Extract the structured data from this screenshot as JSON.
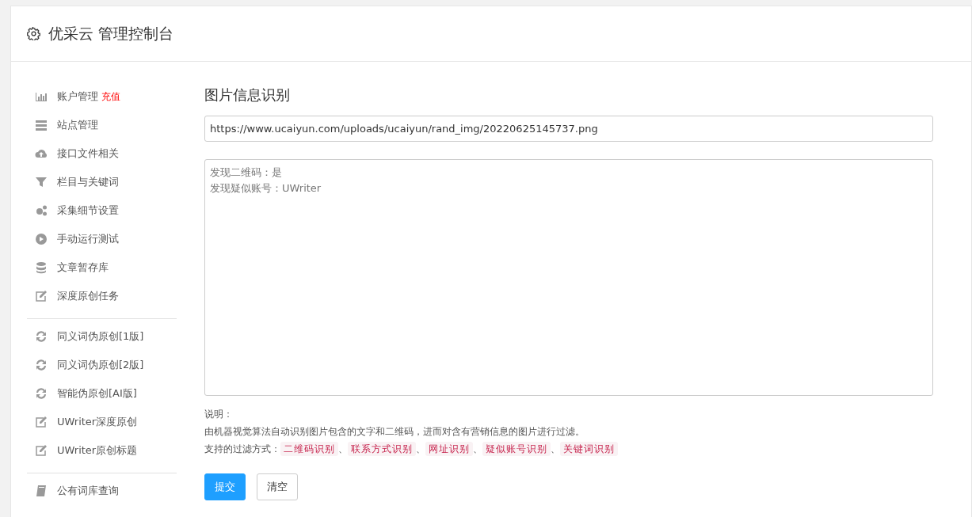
{
  "header": {
    "title": "优采云 管理控制台"
  },
  "sidebar": {
    "groups": [
      {
        "items": [
          {
            "label": "账户管理",
            "badge": "充值"
          },
          {
            "label": "站点管理"
          },
          {
            "label": "接口文件相关"
          },
          {
            "label": "栏目与关键词"
          },
          {
            "label": "采集细节设置"
          },
          {
            "label": "手动运行测试"
          },
          {
            "label": "文章暂存库"
          },
          {
            "label": "深度原创任务"
          }
        ]
      },
      {
        "items": [
          {
            "label": "同义词伪原创[1版]"
          },
          {
            "label": "同义词伪原创[2版]"
          },
          {
            "label": "智能伪原创[AI版]"
          },
          {
            "label": "UWriter深度原创"
          },
          {
            "label": "UWriter原创标题"
          }
        ]
      },
      {
        "items": [
          {
            "label": "公有词库查询"
          }
        ]
      }
    ]
  },
  "main": {
    "title": "图片信息识别",
    "url_field": {
      "value": "https://www.ucaiyun.com/uploads/ucaiyun/rand_img/20220625145737.png"
    },
    "result_lines": [
      "发现二维码：是",
      "发现疑似账号：UWriter"
    ],
    "note_label": "说明：",
    "note_text": "由机器视觉算法自动识别图片包含的文字和二维码，进而对含有营销信息的图片进行过滤。",
    "filters_label": "支持的过滤方式：",
    "separator": "、",
    "filters": [
      "二维码识别",
      "联系方式识别",
      "网址识别",
      "疑似账号识别",
      "关键词识别"
    ],
    "buttons": [
      {
        "label": "提交",
        "kind": "primary"
      },
      {
        "label": "清空",
        "kind": "default"
      }
    ]
  }
}
